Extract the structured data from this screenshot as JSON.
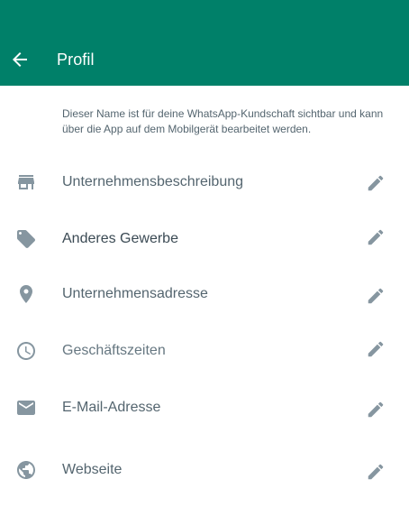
{
  "header": {
    "title": "Profil",
    "background": "#008069"
  },
  "notice": "Dieser Name ist für deine WhatsApp-Kundschaft sichtbar und kann über die App auf dem Mobilgerät bearbeitet werden.",
  "rows": [
    {
      "label": "Unternehmensbeschreibung",
      "icon": "store-icon"
    },
    {
      "label": "Anderes Gewerbe",
      "icon": "tag-icon"
    },
    {
      "label": "Unternehmensadresse",
      "icon": "location-pin-icon"
    },
    {
      "label": "Geschäftszeiten",
      "icon": "clock-icon"
    },
    {
      "label": "E-Mail-Adresse",
      "icon": "mail-icon"
    },
    {
      "label": "Webseite",
      "icon": "globe-icon"
    }
  ],
  "colors": {
    "icon": "#8696a0",
    "text": "#54656f"
  }
}
